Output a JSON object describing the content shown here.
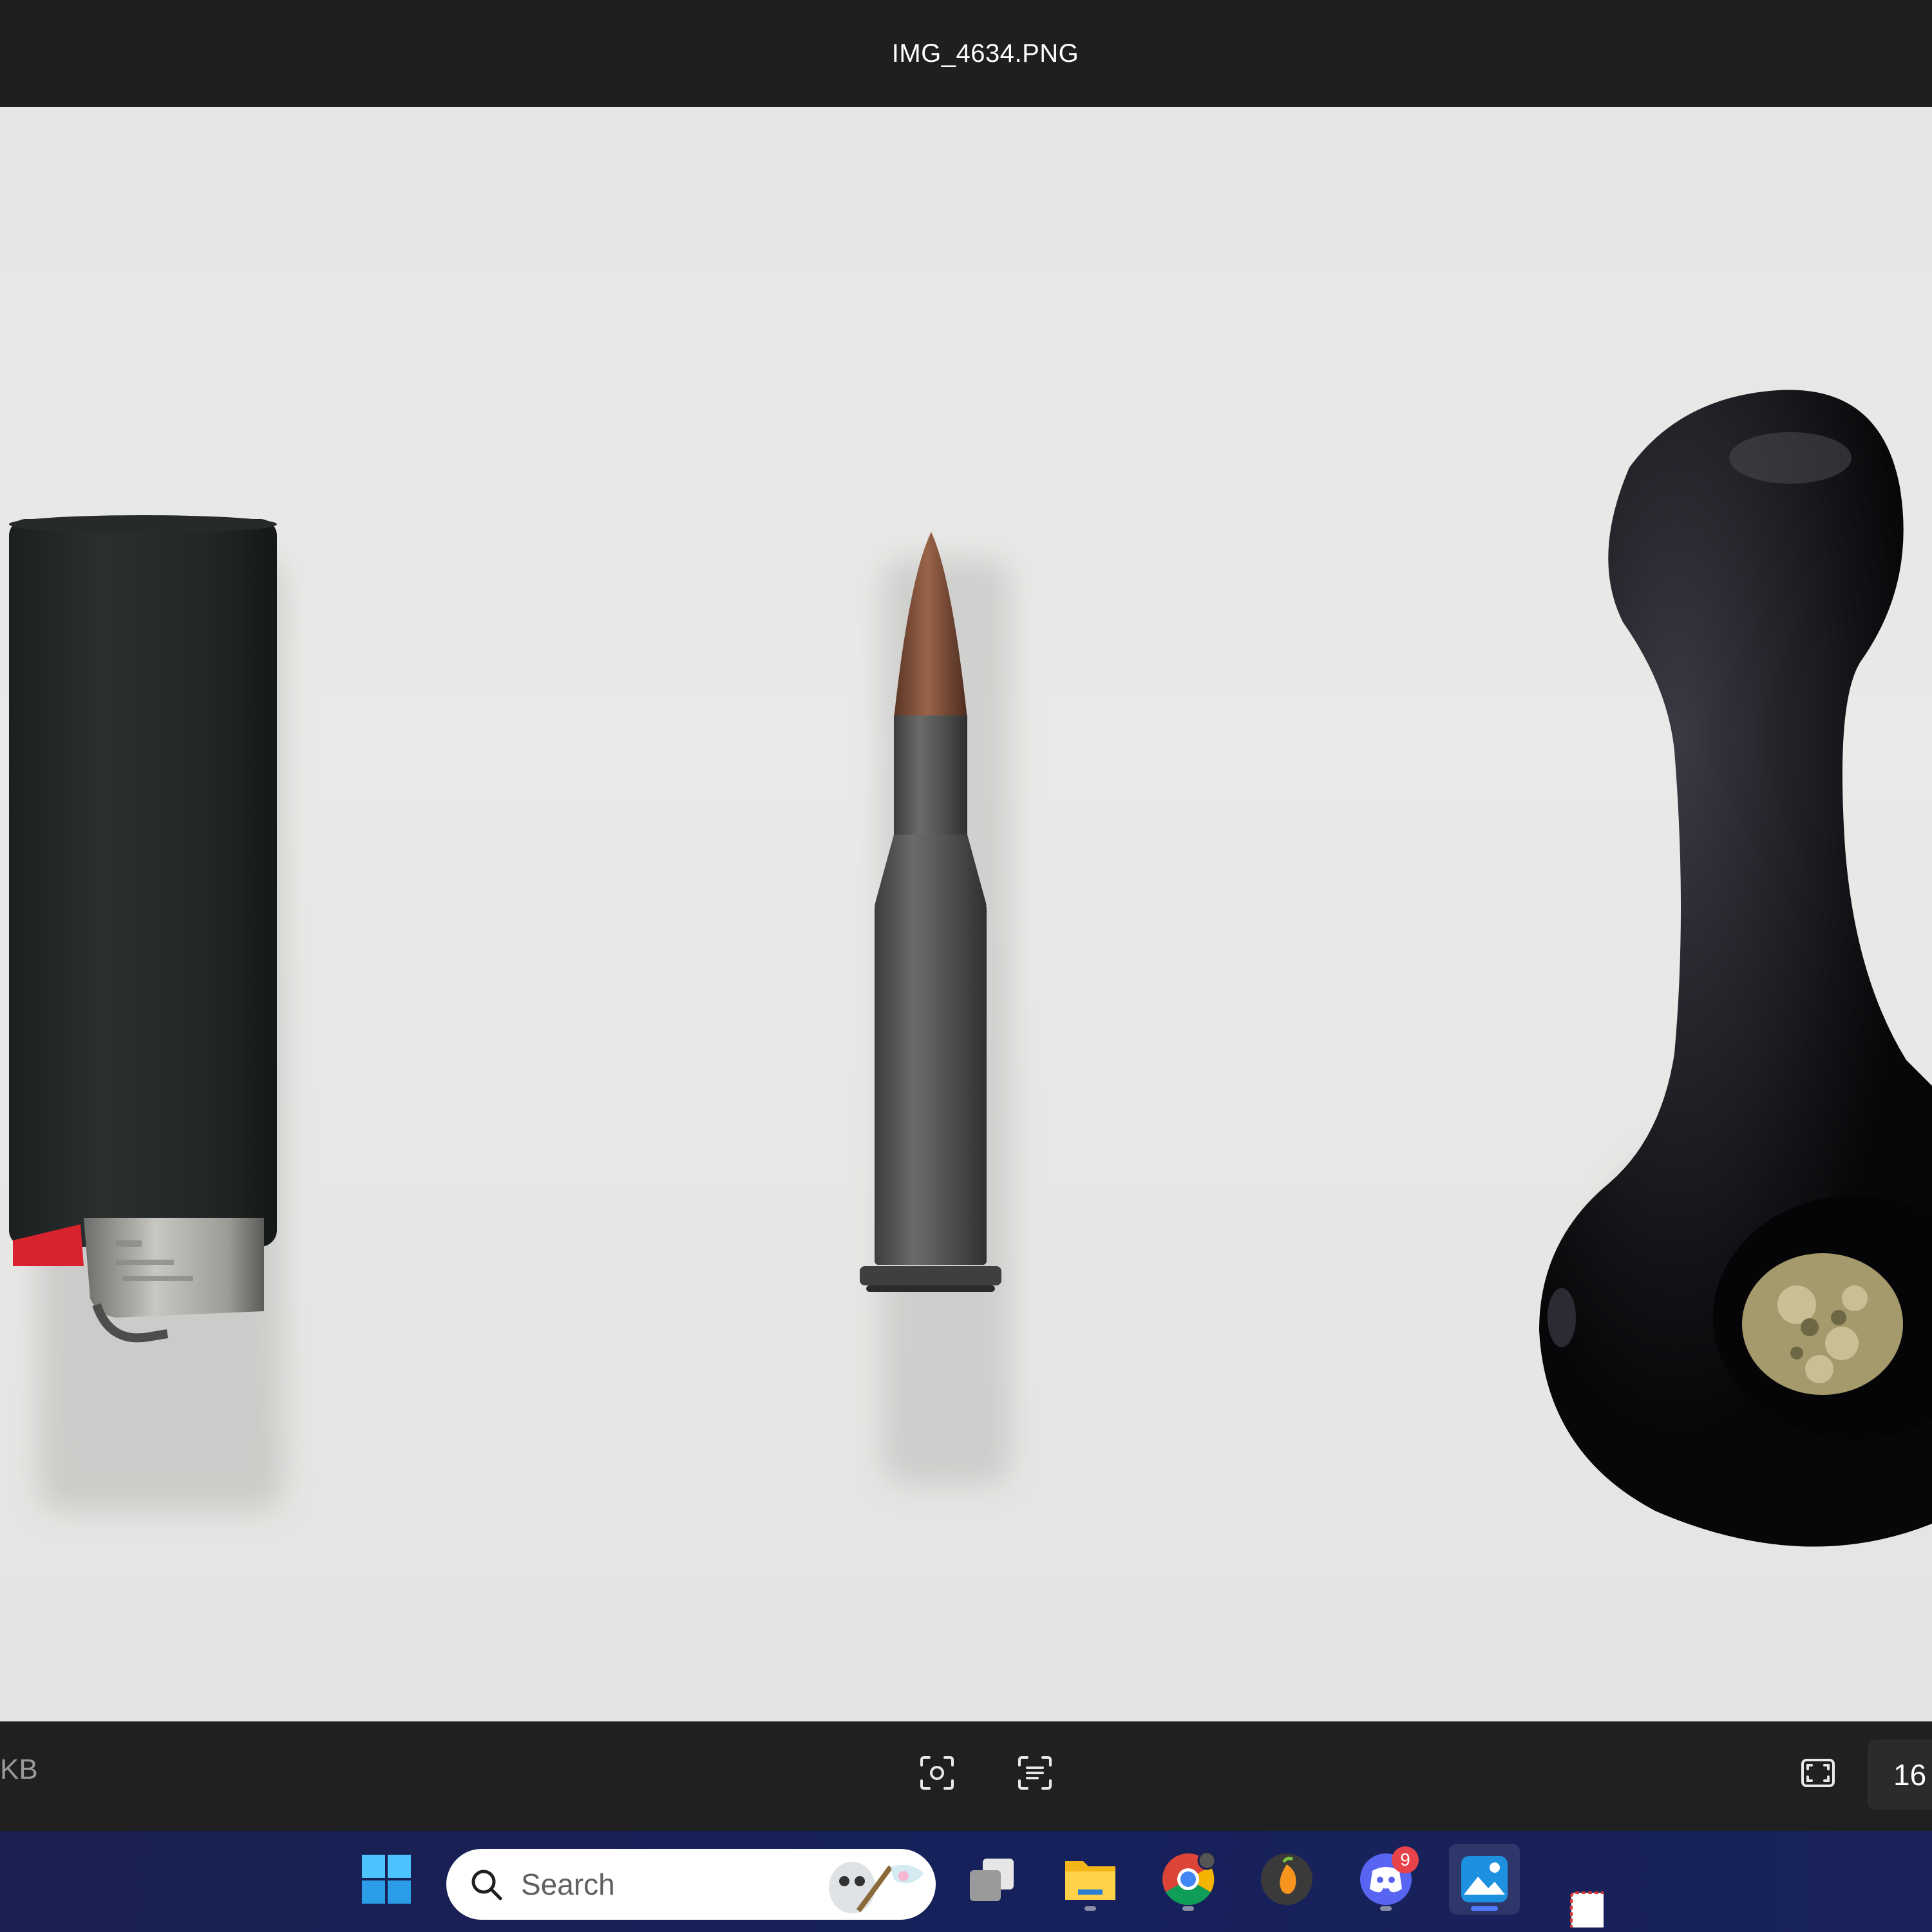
{
  "window": {
    "title": "IMG_4634.PNG"
  },
  "bottom_bar": {
    "file_size_fragment": "KB",
    "zoom_fragment": "16"
  },
  "tools": [
    {
      "icon": "visual-search-icon"
    },
    {
      "icon": "text-extract-icon"
    },
    {
      "icon": "fullscreen-icon"
    }
  ],
  "taskbar": {
    "search_placeholder": "Search",
    "items": [
      {
        "icon": "windows-start-icon"
      },
      {
        "icon": "task-view-icon"
      },
      {
        "icon": "file-explorer-icon"
      },
      {
        "icon": "chrome-icon"
      },
      {
        "icon": "fl-studio-icon"
      },
      {
        "icon": "discord-icon",
        "badge": "9"
      },
      {
        "icon": "photos-icon",
        "active": true
      },
      {
        "icon": "snipping-tool-icon"
      }
    ]
  },
  "photo": {
    "objects": [
      "lighter",
      "rifle-cartridge",
      "glass-pipe"
    ]
  }
}
